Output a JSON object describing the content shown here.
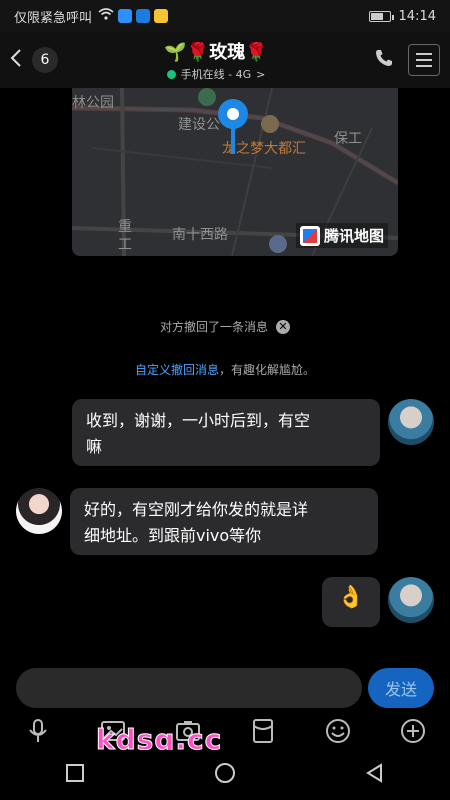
{
  "status_bar": {
    "carrier": "仅限紧急呼叫",
    "time": "14:14",
    "battery_percent": 70
  },
  "header": {
    "back_count": "6",
    "title": "🌱🌹玫瑰🌹",
    "subtitle": "手机在线 - 4G",
    "subtitle_arrow": ">"
  },
  "map": {
    "labels": [
      "林公园",
      "建设公",
      "龙之梦大都汇",
      "保工",
      "重",
      "工",
      "南十西路"
    ],
    "logo_text": "腾讯地图"
  },
  "system": {
    "recall_notice": "对方撤回了一条消息",
    "custom_link": "自定义撤回消息",
    "custom_tail": "，有趣化解尴尬。"
  },
  "messages": [
    {
      "side": "right",
      "text_line1": "收到，谢谢，一小时后到，有空",
      "text_line2": "嘛"
    },
    {
      "side": "left",
      "text_line1": "好的，有空刚才给你发的就是详",
      "text_line2": "细地址。到跟前vivo等你"
    },
    {
      "side": "right",
      "text": "👌"
    }
  ],
  "input": {
    "send_label": "发送"
  },
  "toolbar_icons": [
    "microphone-icon",
    "image-icon",
    "camera-icon",
    "red-packet-icon",
    "emoji-icon",
    "plus-icon"
  ],
  "watermark": "kdsq.cc",
  "colors": {
    "accent": "#1565c0",
    "link": "#4aa3ff",
    "online": "#19c37d"
  }
}
